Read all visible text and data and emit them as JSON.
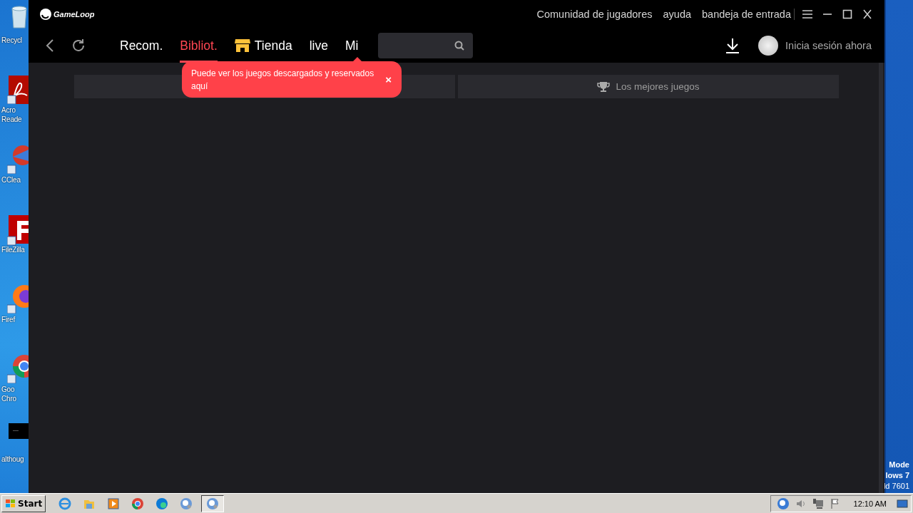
{
  "desktop": {
    "icons": [
      {
        "kind": "recycle",
        "lines": [
          "Recycl"
        ]
      },
      {
        "kind": "pdf",
        "lines": [
          "Acro",
          "Reade"
        ]
      },
      {
        "kind": "cleaner",
        "lines": [
          "CClea"
        ]
      },
      {
        "kind": "ftp",
        "lines": [
          "FileZilla"
        ]
      },
      {
        "kind": "firefox",
        "lines": [
          "Firef"
        ]
      },
      {
        "kind": "chrome",
        "lines": [
          "Goo",
          "Chro"
        ]
      },
      {
        "kind": "blank",
        "lines": [
          "althoug"
        ]
      }
    ],
    "corner_text": [
      "Mode",
      "lows 7",
      "ld 7601"
    ]
  },
  "window": {
    "logo": "GameLoop",
    "top_links": [
      "Comunidad de jugadores",
      "ayuda",
      "bandeja de entrada"
    ],
    "nav_tabs": [
      {
        "kind": "text",
        "label": "Recom.",
        "selected": false
      },
      {
        "kind": "text",
        "label": "Bibliot.",
        "selected": true
      },
      {
        "kind": "store",
        "label": "Tienda",
        "selected": false
      },
      {
        "kind": "text",
        "label": "live",
        "selected": false
      },
      {
        "kind": "text",
        "label": "Mi",
        "selected": false
      }
    ],
    "account": "Inicia sesión ahora",
    "content_tabs": [
      {
        "kind": "plain"
      },
      {
        "kind": "trophy",
        "label": "Los mejores juegos"
      }
    ],
    "tooltip": {
      "text": "Puede ver los juegos descargados y reservados aquí",
      "close": "×"
    }
  },
  "taskbar": {
    "start": "Start",
    "apps": [
      {
        "kind": "ie",
        "selected": false
      },
      {
        "kind": "folder",
        "selected": false
      },
      {
        "kind": "media",
        "selected": false
      },
      {
        "kind": "chrome",
        "selected": false
      },
      {
        "kind": "edge",
        "selected": false
      },
      {
        "kind": "gameloop",
        "selected": false
      },
      {
        "kind": "gameloop",
        "selected": true
      }
    ],
    "clock": "12:10 AM"
  }
}
